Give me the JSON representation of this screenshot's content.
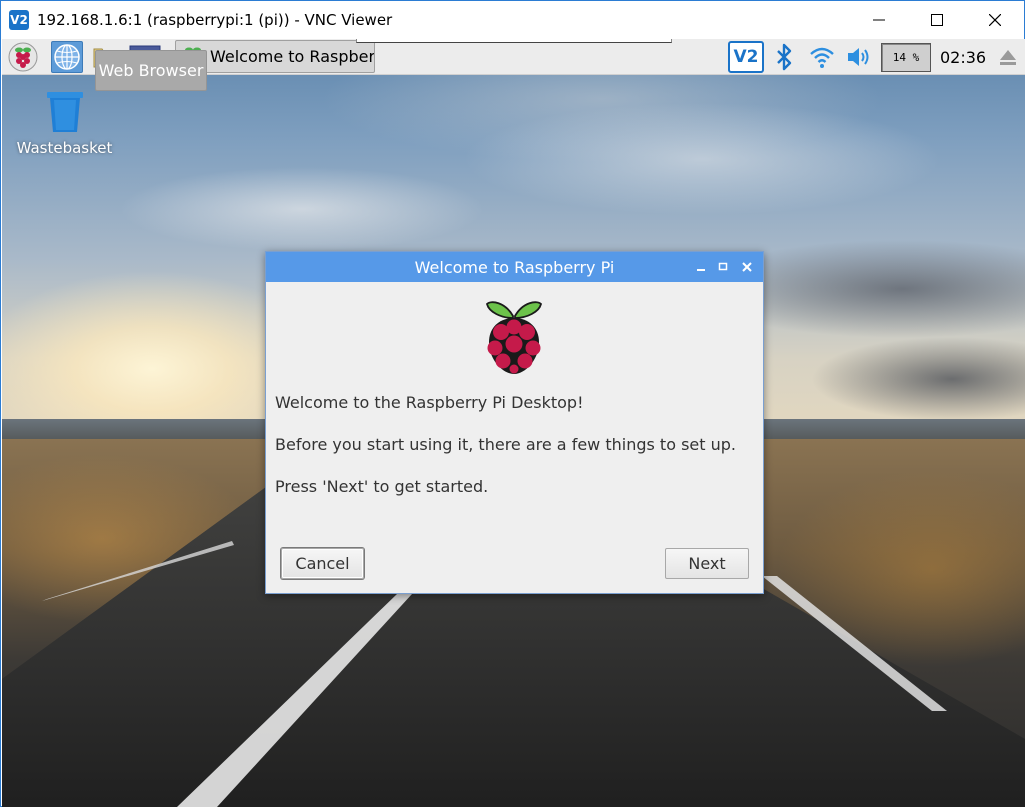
{
  "window": {
    "title": "192.168.1.6:1 (raspberrypi:1 (pi)) - VNC Viewer",
    "logo_text": "V2"
  },
  "panel": {
    "task_label": "Welcome to Raspberr...",
    "tooltip": "Web Browser",
    "vnc_tray_text": "V2",
    "cpu_usage": "14 %",
    "clock": "02:36"
  },
  "desktop": {
    "trash_label": "Wastebasket"
  },
  "dialog": {
    "title": "Welcome to Raspberry Pi",
    "line1": "Welcome to the Raspberry Pi Desktop!",
    "line2": "Before you start using it, there are a few things to set up.",
    "line3": "Press 'Next' to get started.",
    "cancel_label": "Cancel",
    "next_label": "Next"
  },
  "colors": {
    "accent": "#5699e8",
    "vnc_blue": "#1a73c8"
  }
}
